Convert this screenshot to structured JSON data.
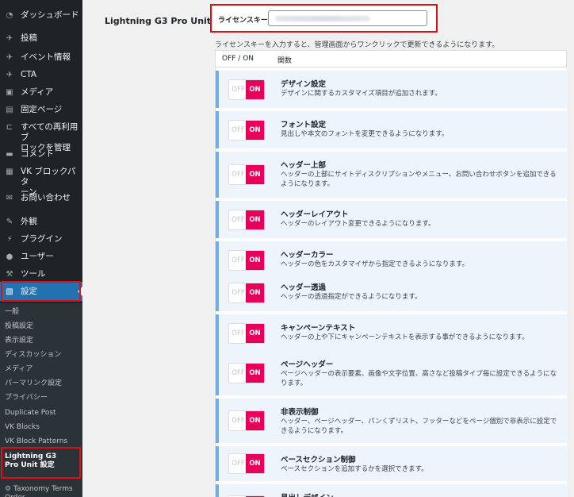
{
  "sidebar": {
    "items": [
      {
        "label": "ダッシュボード",
        "icon": "dashboard-icon"
      },
      {
        "label": "投稿",
        "icon": "pin-icon"
      },
      {
        "label": "イベント情報",
        "icon": "pin-icon"
      },
      {
        "label": "CTA",
        "icon": "pin-icon"
      },
      {
        "label": "メディア",
        "icon": "media-icon"
      },
      {
        "label": "固定ページ",
        "icon": "page-icon"
      },
      {
        "label": "すべての再利用ブ\nロックを管理",
        "icon": "blocks-icon"
      },
      {
        "label": "コメント",
        "icon": "comment-icon"
      },
      {
        "label": "VK ブロックパタ\nーン",
        "icon": "grid-icon"
      },
      {
        "label": "お問い合わせ",
        "icon": "mail-icon"
      },
      {
        "label": "外観",
        "icon": "brush-icon"
      },
      {
        "label": "プラグイン",
        "icon": "plugin-icon"
      },
      {
        "label": "ユーザー",
        "icon": "user-icon"
      },
      {
        "label": "ツール",
        "icon": "wrench-icon"
      },
      {
        "label": "設定",
        "icon": "settings-icon"
      }
    ],
    "submenu": [
      "一般",
      "投稿設定",
      "表示設定",
      "ディスカッション",
      "メディア",
      "パーマリンク設定",
      "プライバシー",
      "Duplicate Post",
      "VK Blocks",
      "VK Block Patterns",
      "Lightning G3\nPro Unit 設定",
      "Taxonomy Terms\nOrder"
    ]
  },
  "main": {
    "setting_label": "Lightning G3 Pro Unit",
    "license_label": "ライセンスキー：",
    "license_desc": "ライセンスキーを入力すると、管理画面からワンクリックで更新できるようになります。",
    "table_header": {
      "offon": "OFF / ON",
      "func": "関数"
    },
    "toggle": {
      "off": "OFF",
      "on": "ON"
    },
    "rows": [
      {
        "title": "デザイン設定",
        "desc": "デザインに関するカスタマイズ項目が追加されます。"
      },
      {
        "title": "フォント設定",
        "desc": "見出しや本文のフォントを変更できるようになります。"
      },
      {
        "title": "ヘッダー上部",
        "desc": "ヘッダーの上部にサイトディスクリプションやメニュー、お問い合わせボタンを追加できるようになります。"
      },
      {
        "title": "ヘッダーレイアウト",
        "desc": "ヘッダーのレイアウト変更できるようになります。"
      },
      {
        "title": "ヘッダーカラー",
        "desc": "ヘッダーの色をカスタマイザから指定できるようになります。"
      },
      {
        "title": "ヘッダー透過",
        "desc": "ヘッダーの透過指定ができるようになります。"
      },
      {
        "title": "キャンペーンテキスト",
        "desc": "ヘッダーの上や下にキャンペーンテキストを表示する事ができるようになります。"
      },
      {
        "title": "ページヘッダー",
        "desc": "ページヘッダーの表示要素、画像や文字位置、高さなど投稿タイプ毎に設定できるようになります。"
      },
      {
        "title": "非表示制御",
        "desc": "ヘッダー、ページヘッダー、パンくずリスト、フッターなどをページ個別で非表示に設定できるようになります。"
      },
      {
        "title": "ベースセクション制御",
        "desc": "ベースセクションを追加するかを選択できます。"
      },
      {
        "title": "見出しデザイン",
        "desc": ""
      }
    ]
  },
  "colors": {
    "sidebar_bg": "#1d2327",
    "active": "#2271b1",
    "toggle_on": "#e6005a",
    "highlight": "#e01010",
    "row_border": "#72aee6"
  }
}
